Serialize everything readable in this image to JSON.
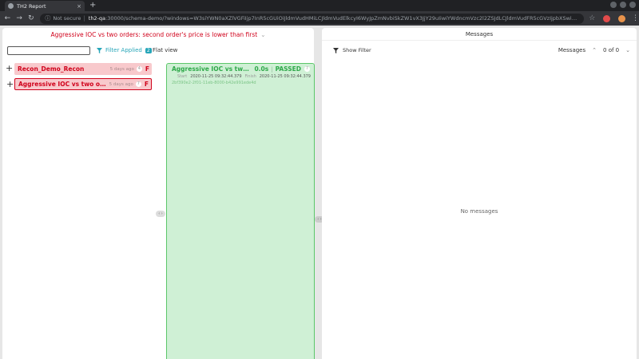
{
  "browser": {
    "tab_title": "TH2 Report",
    "tab_close": "×",
    "new_tab": "+",
    "back": "←",
    "forward": "→",
    "reload": "↻",
    "info_icon": "ⓘ",
    "security_label": "Not secure",
    "address_host": "th2-qa",
    "address_path": ":30000/schema-demo/?windows=W3siYWN0aXZlVGFiIjp7InR5cGUiOiJldmVudHMiLCJldmVudElkcyI6WyJpZmNvbiSkZW1vX3JjY29uIiwiYWdncmVzc2l2ZSJdLCJldmVudFR5cGVzIjpbXSwidGltZXN0YW1wVG8iOjE2MDYyOTY5...",
    "star": "☆",
    "menu": "⋮"
  },
  "left_panel": {
    "header_title": "Aggressive IOC vs two orders: second order's price is lower than first",
    "header_chevron": "⌄",
    "search": {
      "value": "",
      "placeholder": ""
    },
    "filter_label": "Filter Applied",
    "filter_count": "2",
    "flat_view_label": "Flat view",
    "splitter": "‹ ›",
    "tree_items": [
      {
        "plus": "+",
        "name": "Recon_Demo_Recon",
        "ago": "5 days ago",
        "count": "4",
        "status": "F"
      },
      {
        "plus": "+",
        "name": "Aggressive IOC vs two orders: s...",
        "ago": "5 days ago",
        "count": "7",
        "status": "F"
      }
    ],
    "event_card": {
      "name": "Aggressive IOC vs two orders: ...",
      "duration": "0.0s",
      "status": "PASSED",
      "count": "7",
      "start_label": "Start",
      "start_time": "2020-11-25 09:32:44.379",
      "finish_label": "Finish",
      "finish_time": "2020-11-25 09:32:44.379",
      "event_id": "2bf390e2-2f01-11eb-8000-b42e991ede4d"
    }
  },
  "middle_splitter": "‹ ›",
  "right_panel": {
    "header_title": "Messages",
    "show_filter_label": "Show Filter",
    "messages_label": "Messages",
    "up_arrow": "⌃",
    "counter": "0 of 0",
    "down_arrow": "⌄",
    "empty_text": "No messages"
  },
  "colors": {
    "failed_red": "#d0021b",
    "passed_green": "#2fa84a",
    "filter_teal": "#27a6b9"
  }
}
